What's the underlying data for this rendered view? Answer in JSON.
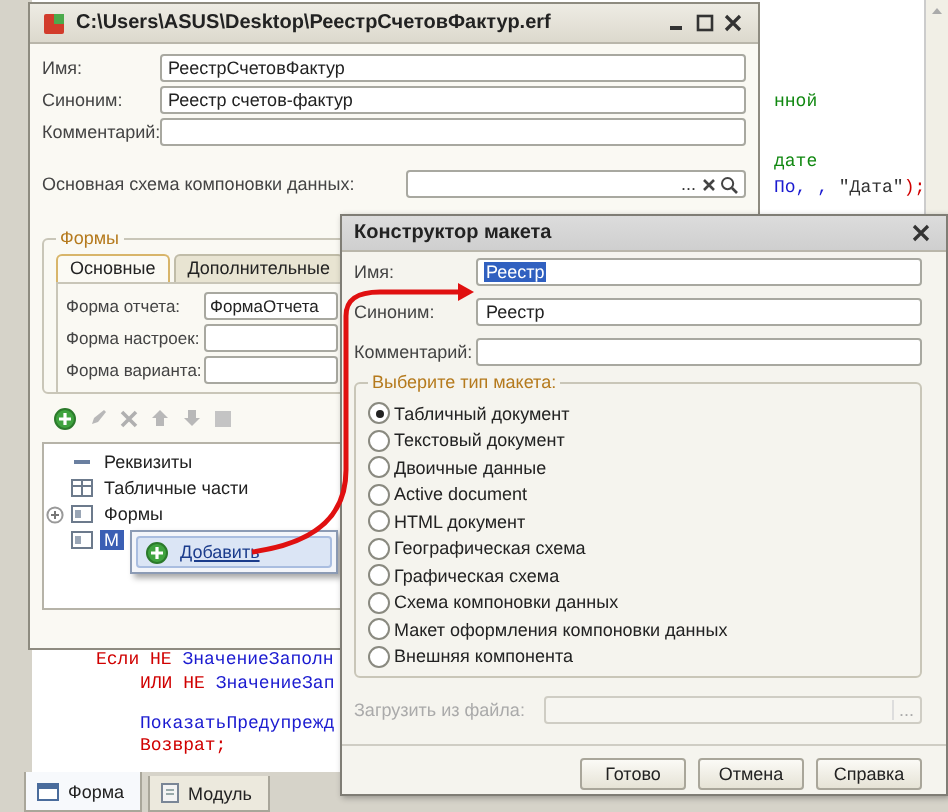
{
  "editor": {
    "right_lines": [
      {
        "tokens": [
          {
            "text": "нной",
            "kind": "comment"
          }
        ]
      },
      {
        "tokens": [
          {
            "text": "дате",
            "kind": "comment"
          }
        ]
      },
      {
        "tokens": [
          {
            "text": "По, , ",
            "kind": "identifier"
          },
          {
            "text": "\"Дата\"",
            "kind": "string"
          },
          {
            "text": ");",
            "kind": "operator"
          }
        ]
      }
    ],
    "bottom_lines": [
      {
        "tokens": [
          {
            "text": "Если НЕ ",
            "kind": "keyword"
          },
          {
            "text": "ЗначениеЗаполн",
            "kind": "identifier"
          }
        ]
      },
      {
        "tokens": [
          {
            "text": "ИЛИ НЕ ",
            "kind": "keyword"
          },
          {
            "text": "ЗначениеЗап",
            "kind": "identifier"
          }
        ]
      },
      {
        "tokens": [
          {
            "text": "ПоказатьПредупрежд",
            "kind": "identifier"
          }
        ]
      },
      {
        "tokens": [
          {
            "text": "Возврат;",
            "kind": "keyword"
          }
        ]
      }
    ],
    "tabs": [
      {
        "label": "Форма",
        "kind": "form",
        "selected": true
      },
      {
        "label": "Модуль",
        "kind": "module",
        "selected": false
      }
    ]
  },
  "main_window": {
    "title": "C:\\Users\\ASUS\\Desktop\\РеестрСчетовФактур.erf",
    "fields": [
      {
        "label": "Имя:",
        "value": "РеестрСчетовФактур"
      },
      {
        "label": "Синоним:",
        "value": "Реестр счетов-фактур"
      },
      {
        "label": "Комментарий:"
      }
    ],
    "schema": {
      "label": "Основная схема компоновки данных:",
      "choose_button": "..."
    },
    "forms_group": {
      "title": "Формы",
      "tabs": [
        {
          "label": "Основные",
          "selected": true
        },
        {
          "label": "Дополнительные",
          "selected": false
        }
      ],
      "fields": [
        {
          "label": "Форма отчета:",
          "value": "ФормаОтчета"
        },
        {
          "label": "Форма настроек:"
        },
        {
          "label": "Форма варианта:"
        }
      ]
    },
    "tree": [
      {
        "label": "Реквизиты",
        "kind": "attributes",
        "expandable": false,
        "selected": false
      },
      {
        "label": "Табличные части",
        "kind": "tables",
        "expandable": false,
        "selected": false
      },
      {
        "label": "Формы",
        "kind": "forms",
        "expandable": true,
        "selected": false
      },
      {
        "label": "М",
        "kind": "layouts",
        "expandable": false,
        "selected": true
      }
    ],
    "context_menu": [
      {
        "label": "Добавить"
      }
    ]
  },
  "dialog": {
    "title": "Конструктор макета",
    "fields": [
      {
        "label": "Имя:",
        "value": "Реестр",
        "text_selected": true
      },
      {
        "label": "Синоним:",
        "value": "Реестр",
        "text_selected": false
      },
      {
        "label": "Комментарий:"
      }
    ],
    "types_title": "Выберите тип макета:",
    "types": [
      {
        "label": "Табличный документ",
        "selected": true
      },
      {
        "label": "Текстовый документ",
        "selected": false
      },
      {
        "label": "Двоичные данные",
        "selected": false
      },
      {
        "label": "Active document",
        "selected": false
      },
      {
        "label": "HTML документ",
        "selected": false
      },
      {
        "label": "Географическая схема",
        "selected": false
      },
      {
        "label": "Графическая схема",
        "selected": false
      },
      {
        "label": "Схема компоновки данных",
        "selected": false
      },
      {
        "label": "Макет оформления компоновки данных",
        "selected": false
      },
      {
        "label": "Внешняя компонента",
        "selected": false
      }
    ],
    "load_file": {
      "label": "Загрузить из файла:",
      "disabled": true,
      "choose_button": "..."
    },
    "buttons": [
      "Готово",
      "Отмена",
      "Справка"
    ]
  }
}
